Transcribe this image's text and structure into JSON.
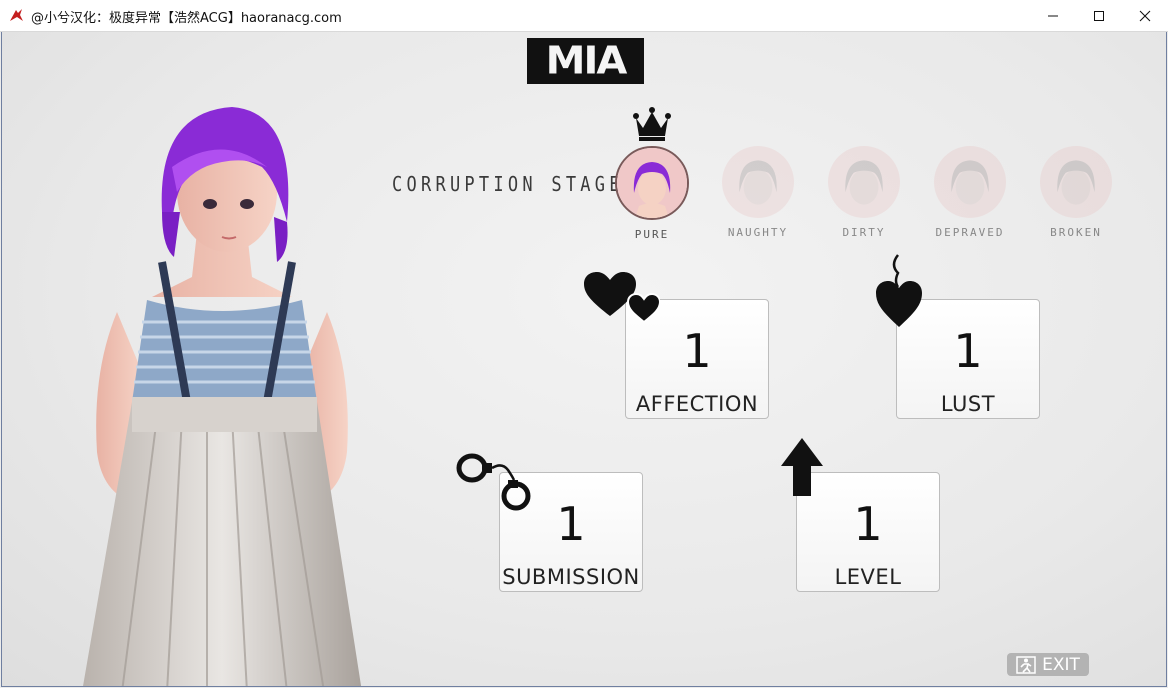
{
  "window": {
    "title": "@小兮汉化：极度异常【浩然ACG】haoranacg.com",
    "minimize_icon": "minimize-icon",
    "maximize_icon": "maximize-icon",
    "close_icon": "close-icon"
  },
  "logo": {
    "text": "MIA"
  },
  "corruption": {
    "label": "CORRUPTION STAGE:",
    "current_icon": "crown-icon",
    "stages": [
      {
        "name": "PURE",
        "active": true
      },
      {
        "name": "NAUGHTY",
        "active": false
      },
      {
        "name": "DIRTY",
        "active": false
      },
      {
        "name": "DEPRAVED",
        "active": false
      },
      {
        "name": "BROKEN",
        "active": false
      }
    ]
  },
  "stats": {
    "affection": {
      "label": "AFFECTION",
      "value": "1",
      "icon": "hearts-icon"
    },
    "lust": {
      "label": "LUST",
      "value": "1",
      "icon": "flaming-heart-icon"
    },
    "submission": {
      "label": "SUBMISSION",
      "value": "1",
      "icon": "handcuffs-icon"
    },
    "level": {
      "label": "LEVEL",
      "value": "1",
      "icon": "up-arrow-icon"
    }
  },
  "exit": {
    "label": "EXIT",
    "icon": "exit-icon"
  },
  "colors": {
    "hair": "#8a2bd6",
    "card_border": "#bdbdbd",
    "exit_bg": "#b3b3b3"
  }
}
